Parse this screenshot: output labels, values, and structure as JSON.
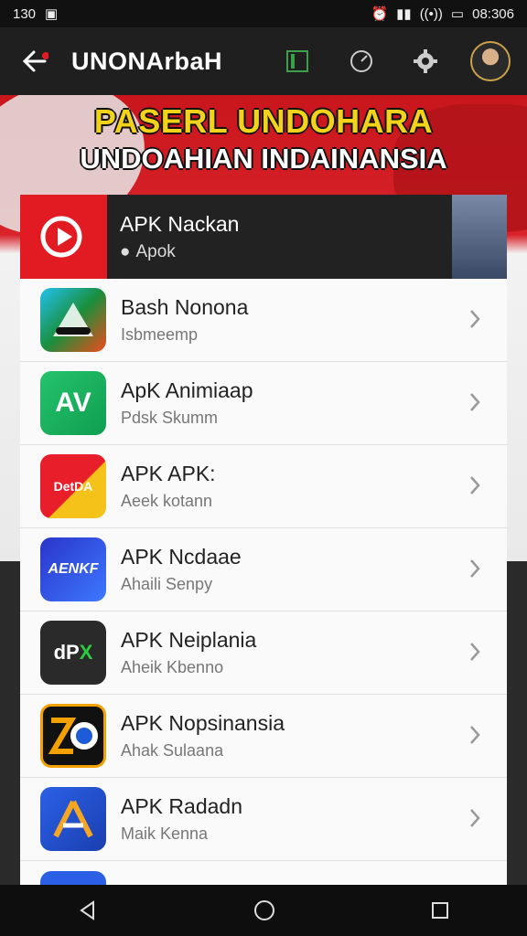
{
  "status": {
    "left_text": "130",
    "time": "08:306",
    "colors": {
      "bg": "#111111"
    }
  },
  "appbar": {
    "title": "UNONArbaH"
  },
  "hero": {
    "headline": "PASERL UNDOHARA",
    "subheadline": "UNDOAHIAN INDAINANSIA"
  },
  "featured": {
    "title": "APK Nackan",
    "subtitle": "Apok"
  },
  "apps": [
    {
      "title": "Bash Nonona",
      "subtitle": "Isbmeemp",
      "icon": "triangle-app-icon",
      "color": "#1e9bf0"
    },
    {
      "title": "ApK Animiaap",
      "subtitle": "Pdsk Skumm",
      "icon": "av-app-icon",
      "color": "#1fbf6a"
    },
    {
      "title": "APK APK:",
      "subtitle": "Aeek kotann",
      "icon": "red-app-icon",
      "color": "#e52020"
    },
    {
      "title": "APK Ncdaae",
      "subtitle": "Ahaili Senpy",
      "icon": "blue-app-icon",
      "color": "#2b3fd6"
    },
    {
      "title": "APK Neiplania",
      "subtitle": "Aheik Kbenno",
      "icon": "dpx-app-icon",
      "color": "#222222"
    },
    {
      "title": "APK Nopsinansia",
      "subtitle": "Ahak Sulaana",
      "icon": "zo-app-icon",
      "color": "#f2a100"
    },
    {
      "title": "APK Radadn",
      "subtitle": "Maik Kenna",
      "icon": "a-app-icon",
      "color": "#2b60e6"
    }
  ],
  "nav": {
    "back": "back-icon",
    "home": "home-icon",
    "recent": "recent-icon"
  }
}
